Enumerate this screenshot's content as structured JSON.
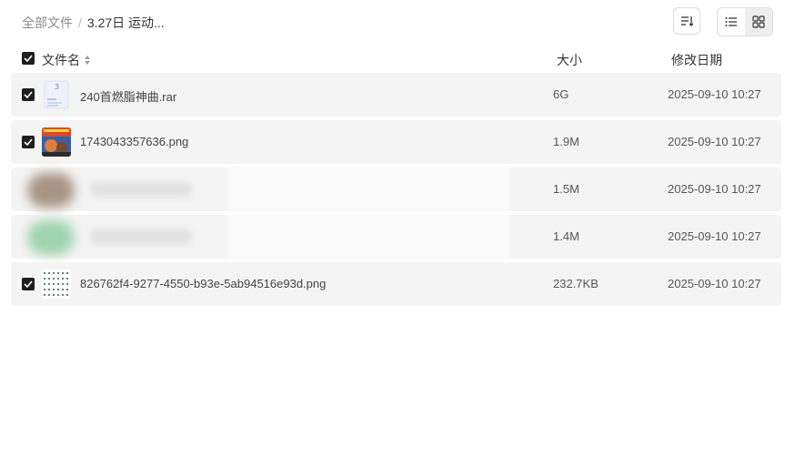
{
  "breadcrumb": {
    "root": "全部文件",
    "separator": "/",
    "current": "3.27日 运动..."
  },
  "toolbar": {
    "sort_icon": "sort-icon",
    "list_view_icon": "list-view-icon",
    "grid_view_icon": "grid-view-icon",
    "active_view": "list"
  },
  "table": {
    "columns": {
      "name": "文件名",
      "size": "大小",
      "date": "修改日期"
    },
    "rows": [
      {
        "name": "240首燃脂神曲.rar",
        "size": "6G",
        "date": "2025-09-10 10:27",
        "thumb": "archive-icon",
        "checked": true
      },
      {
        "name": "1743043357636.png",
        "size": "1.9M",
        "date": "2025-09-10 10:27",
        "thumb": "image-thumbnail",
        "checked": true
      },
      {
        "name": "",
        "size": "1.5M",
        "date": "2025-09-10 10:27",
        "thumb": "blurred",
        "checked": false
      },
      {
        "name": "",
        "size": "1.4M",
        "date": "2025-09-10 10:27",
        "thumb": "blurred",
        "checked": false
      },
      {
        "name": "826762f4-9277-4550-b93e-5ab94516e93d.png",
        "size": "232.7KB",
        "date": "2025-09-10 10:27",
        "thumb": "image-thumbnail",
        "checked": true
      }
    ]
  },
  "colors": {
    "row_bg": "#f4f4f4",
    "checkbox": "#1f1f1f",
    "muted_text": "#8a8a8a"
  }
}
